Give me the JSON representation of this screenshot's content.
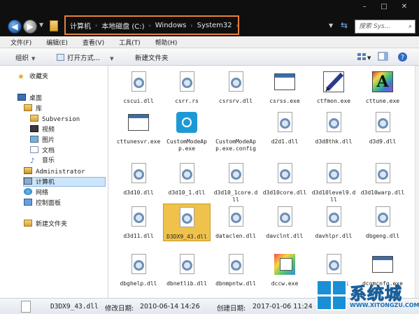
{
  "window": {
    "controls": [
      "–",
      "□",
      "✕"
    ]
  },
  "address_bar": {
    "segments": [
      "计算机",
      "本地磁盘 (C:)",
      "Windows",
      "System32"
    ],
    "separator": "›"
  },
  "search": {
    "placeholder": "搜索 Sys..."
  },
  "menu": [
    "文件(F)",
    "编辑(E)",
    "查看(V)",
    "工具(T)",
    "帮助(H)"
  ],
  "toolbar": {
    "organize": "组织",
    "open_with": "打开方式...",
    "new_folder": "新建文件夹"
  },
  "sidebar": {
    "items": [
      {
        "label": "收藏夹",
        "icon": "star-icon"
      },
      {
        "label": "桌面",
        "icon": "desktop-icon"
      },
      {
        "label": "库",
        "icon": "library-icon"
      },
      {
        "label": "Subversion",
        "icon": "folder-icon"
      },
      {
        "label": "视频",
        "icon": "video-icon"
      },
      {
        "label": "图片",
        "icon": "picture-icon"
      },
      {
        "label": "文档",
        "icon": "document-icon"
      },
      {
        "label": "音乐",
        "icon": "music-icon"
      },
      {
        "label": "Administrator",
        "icon": "user-folder-icon"
      },
      {
        "label": "计算机",
        "icon": "computer-icon",
        "selected": true
      },
      {
        "label": "网络",
        "icon": "network-icon"
      },
      {
        "label": "控制面板",
        "icon": "control-panel-icon"
      },
      {
        "label": "新建文件夹",
        "icon": "folder-icon"
      }
    ]
  },
  "files": [
    {
      "name": "cscui.dll",
      "type": "dll"
    },
    {
      "name": "csrr.rs",
      "type": "dll"
    },
    {
      "name": "csrsrv.dll",
      "type": "dll"
    },
    {
      "name": "csrss.exe",
      "type": "exe"
    },
    {
      "name": "ctfmon.exe",
      "type": "pen"
    },
    {
      "name": "cttune.exe",
      "type": "cttune"
    },
    {
      "name": "cttunesvr.exe",
      "type": "exe"
    },
    {
      "name": "CustomModeApp.exe",
      "type": "intel"
    },
    {
      "name": "CustomModeApp.exe.config",
      "type": "blank"
    },
    {
      "name": "d2d1.dll",
      "type": "dll"
    },
    {
      "name": "d3d8thk.dll",
      "type": "dll"
    },
    {
      "name": "d3d9.dll",
      "type": "dll"
    },
    {
      "name": "d3d10.dll",
      "type": "dll"
    },
    {
      "name": "d3d10_1.dll",
      "type": "dll"
    },
    {
      "name": "d3d10_1core.dll",
      "type": "dll"
    },
    {
      "name": "d3d10core.dll",
      "type": "dll"
    },
    {
      "name": "d3d10level9.dll",
      "type": "dll"
    },
    {
      "name": "d3d10warp.dll",
      "type": "dll"
    },
    {
      "name": "d3d11.dll",
      "type": "dll"
    },
    {
      "name": "D3DX9_43.dll",
      "type": "dll",
      "selected": true
    },
    {
      "name": "dataclen.dll",
      "type": "dll"
    },
    {
      "name": "davclnt.dll",
      "type": "dll"
    },
    {
      "name": "davhlpr.dll",
      "type": "dll"
    },
    {
      "name": "dbgeng.dll",
      "type": "dll"
    },
    {
      "name": "dbghelp.dll",
      "type": "dll"
    },
    {
      "name": "dbnetlib.dll",
      "type": "dll"
    },
    {
      "name": "dbnmpntw.dll",
      "type": "dll"
    },
    {
      "name": "dccw.exe",
      "type": "dccw"
    },
    {
      "name": "ddraw.dll",
      "type": "dll"
    },
    {
      "name": "dcomcnfg.exe",
      "type": "exe"
    }
  ],
  "status": {
    "file_name": "D3DX9_43.dll",
    "modified_label": "修改日期:",
    "modified_value": "2010-06-14 14:26",
    "created_label": "创建日期:",
    "created_value": "2017-01-06 11:24"
  },
  "watermark": {
    "title": "系统城",
    "url": "WWW.XITONGZU.COM"
  }
}
